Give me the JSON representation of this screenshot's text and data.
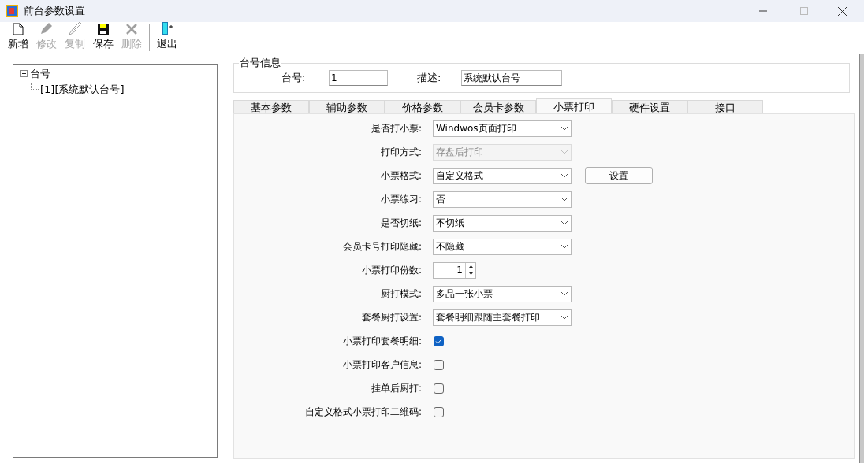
{
  "window": {
    "title": "前台参数设置"
  },
  "toolbar": [
    {
      "kind": "new",
      "label": "新增",
      "disabled": false
    },
    {
      "kind": "edit",
      "label": "修改",
      "disabled": true
    },
    {
      "kind": "copy",
      "label": "复制",
      "disabled": true
    },
    {
      "kind": "save",
      "label": "保存",
      "disabled": false
    },
    {
      "kind": "delete",
      "label": "删除",
      "disabled": true
    },
    {
      "kind": "exit",
      "label": "退出",
      "disabled": false
    }
  ],
  "tree": {
    "label": "台号",
    "expanded": true,
    "children": [
      {
        "label": "[1][系统默认台号]"
      }
    ]
  },
  "info": {
    "title": "台号信息",
    "fields": [
      {
        "label": "台号:",
        "value": "1"
      },
      {
        "label": "描述:",
        "value": "系统默认台号"
      }
    ]
  },
  "tabs": [
    {
      "label": "基本参数",
      "selected": false
    },
    {
      "label": "辅助参数",
      "selected": false
    },
    {
      "label": "价格参数",
      "selected": false
    },
    {
      "label": "会员卡参数",
      "selected": false
    },
    {
      "label": "小票打印",
      "selected": true
    },
    {
      "label": "硬件设置",
      "selected": false
    },
    {
      "label": "接口",
      "selected": false
    }
  ],
  "settings": [
    {
      "kind": "select",
      "label": "是否打小票:",
      "value": "Windwos页面打印",
      "disabled": false
    },
    {
      "kind": "select",
      "label": "打印方式:",
      "value": "存盘后打印",
      "disabled": true
    },
    {
      "kind": "select",
      "label": "小票格式:",
      "value": "自定义格式",
      "disabled": false,
      "button": "设置"
    },
    {
      "kind": "select",
      "label": "小票练习:",
      "value": "否",
      "disabled": false
    },
    {
      "kind": "select",
      "label": "是否切纸:",
      "value": "不切纸",
      "disabled": false
    },
    {
      "kind": "select",
      "label": "会员卡号打印隐藏:",
      "value": "不隐藏",
      "disabled": false
    },
    {
      "kind": "spin",
      "label": "小票打印份数:",
      "value": "1"
    },
    {
      "kind": "select",
      "label": "厨打模式:",
      "value": "多品一张小票",
      "disabled": false
    },
    {
      "kind": "select",
      "label": "套餐厨打设置:",
      "value": "套餐明细跟随主套餐打印",
      "disabled": false
    },
    {
      "kind": "checkbox",
      "label": "小票打印套餐明细:",
      "checked": true
    },
    {
      "kind": "checkbox",
      "label": "小票打印客户信息:",
      "checked": false
    },
    {
      "kind": "checkbox",
      "label": "挂单后厨打:",
      "checked": false
    },
    {
      "kind": "checkbox",
      "label": "自定义格式小票打印二维码:",
      "checked": false
    }
  ]
}
